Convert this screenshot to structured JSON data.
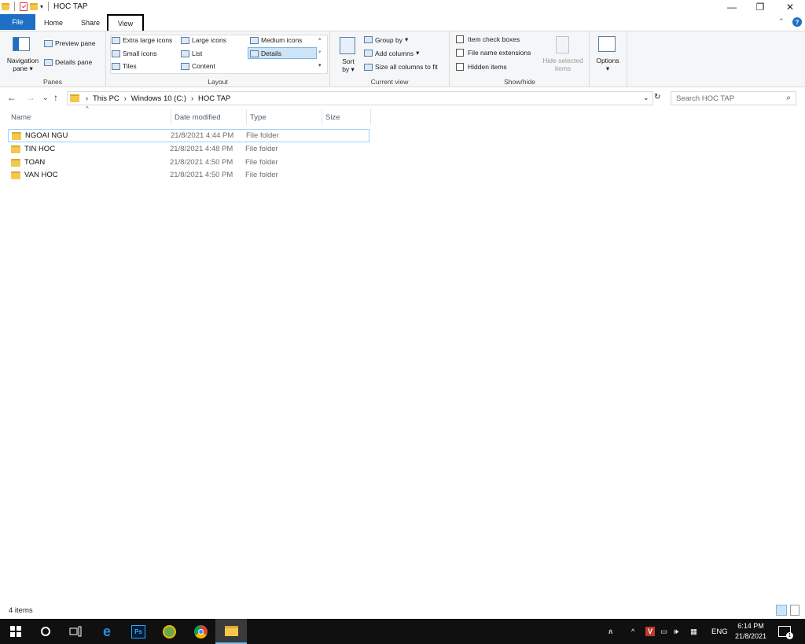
{
  "window": {
    "title": "HOC TAP",
    "controls": [
      "minimize-icon",
      "restore-icon",
      "close-icon"
    ]
  },
  "tabs": {
    "file": "File",
    "home": "Home",
    "share": "Share",
    "view": "View"
  },
  "ribbon": {
    "panes": {
      "label": "Panes",
      "navigation_pane": "Navigation",
      "navigation_pane_2": "pane",
      "preview_pane": "Preview pane",
      "details_pane": "Details pane"
    },
    "layout": {
      "label": "Layout",
      "extra_large": "Extra large icons",
      "large": "Large icons",
      "medium": "Medium icons",
      "small": "Small icons",
      "list": "List",
      "details": "Details",
      "tiles": "Tiles",
      "content": "Content"
    },
    "current_view": {
      "label": "Current view",
      "sort_by": "Sort",
      "sort_by_2": "by",
      "group_by": "Group by",
      "add_columns": "Add columns",
      "size_all": "Size all columns to fit"
    },
    "show_hide": {
      "label": "Show/hide",
      "item_check_boxes": "Item check boxes",
      "file_name_extensions": "File name extensions",
      "hidden_items": "Hidden items",
      "hide_selected": "Hide selected",
      "hide_selected_2": "items"
    },
    "options": "Options"
  },
  "address": {
    "crumbs": [
      "This PC",
      "Windows 10 (C:)",
      "HOC TAP"
    ],
    "search_placeholder": "Search HOC TAP"
  },
  "columns": {
    "name": "Name",
    "date": "Date modified",
    "type": "Type",
    "size": "Size"
  },
  "files": [
    {
      "name": "NGOAI NGU",
      "date": "21/8/2021 4:44 PM",
      "type": "File folder",
      "size": ""
    },
    {
      "name": "TIN HOC",
      "date": "21/8/2021 4:48 PM",
      "type": "File folder",
      "size": ""
    },
    {
      "name": "TOAN",
      "date": "21/8/2021 4:50 PM",
      "type": "File folder",
      "size": ""
    },
    {
      "name": "VAN HOC",
      "date": "21/8/2021 4:50 PM",
      "type": "File folder",
      "size": ""
    }
  ],
  "status": {
    "count": "4 items"
  },
  "taskbar": {
    "apps": [
      "windows-start-icon",
      "cortana-icon",
      "task-view-icon",
      "edge-icon",
      "photoshop-icon",
      "app-icon",
      "chrome-icon",
      "file-explorer-icon"
    ],
    "photoshop_label": "Ps",
    "lang": "ENG",
    "time": "6:14 PM",
    "date": "21/8/2021",
    "notif": "1"
  }
}
